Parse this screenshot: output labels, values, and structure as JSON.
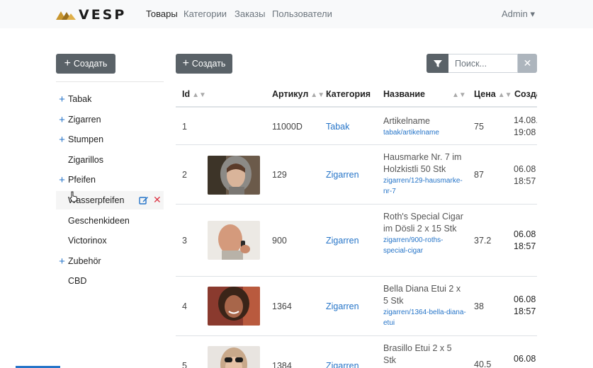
{
  "brand": {
    "name": "VESP",
    "gold": "#c8962e"
  },
  "nav": {
    "items": [
      "Товары",
      "Категории",
      "Заказы",
      "Пользователи"
    ],
    "active": "Товары",
    "user": "Admin ▾"
  },
  "sidebar": {
    "create_label": "Создать",
    "categories": [
      {
        "label": "Tabak",
        "expandable": true
      },
      {
        "label": "Zigarren",
        "expandable": true
      },
      {
        "label": "Stumpen",
        "expandable": true
      },
      {
        "label": "Zigarillos",
        "expandable": false
      },
      {
        "label": "Pfeifen",
        "expandable": true
      },
      {
        "label": "Wasserpfeifen",
        "expandable": false,
        "hovered": true
      },
      {
        "label": "Geschenkideen",
        "expandable": false
      },
      {
        "label": "Victorinox",
        "expandable": false
      },
      {
        "label": "Zubehör",
        "expandable": true
      },
      {
        "label": "CBD",
        "expandable": false
      }
    ]
  },
  "toolbar": {
    "create_label": "Создать",
    "search_placeholder": "Поиск...",
    "clear_label": "✕"
  },
  "table": {
    "columns": [
      "Id",
      "Артикул",
      "Категория",
      "Название",
      "Цена",
      "Созда"
    ],
    "rows": [
      {
        "id": "1",
        "sku": "11000D",
        "category": "Tabak",
        "name": "Artikelname",
        "slug": "tabak/artikelname",
        "price": "75",
        "date": "14.08.",
        "time": "19:08",
        "image": "none"
      },
      {
        "id": "2",
        "sku": "129",
        "category": "Zigarren",
        "name": "Hausmarke Nr. 7 im Holzkistli 50 Stk",
        "slug": "zigarren/129-hausmarke-nr-7",
        "price": "87",
        "date": "06.08",
        "time": "18:57",
        "image": "woman-hood-photo"
      },
      {
        "id": "3",
        "sku": "900",
        "category": "Zigarren",
        "name": "Roth's Special Cigar im Dösli 2 x 15 Stk",
        "slug": "zigarren/900-roths-special-cigar",
        "price": "37.2",
        "date": "06.08",
        "time": "18:57",
        "image": "man-phone-photo"
      },
      {
        "id": "4",
        "sku": "1364",
        "category": "Zigarren",
        "name": "Bella Diana Etui 2 x 5 Stk",
        "slug": "zigarren/1364-bella-diana-etui",
        "price": "38",
        "date": "06.08",
        "time": "18:57",
        "image": "woman-smiling-photo"
      },
      {
        "id": "5",
        "sku": "1384",
        "category": "Zigarren",
        "name": "Brasillo Etui 2 x 5 Stk",
        "slug": "",
        "price": "40.5",
        "date": "06.08",
        "time": "",
        "image": "woman-sunglasses-photo"
      }
    ]
  }
}
